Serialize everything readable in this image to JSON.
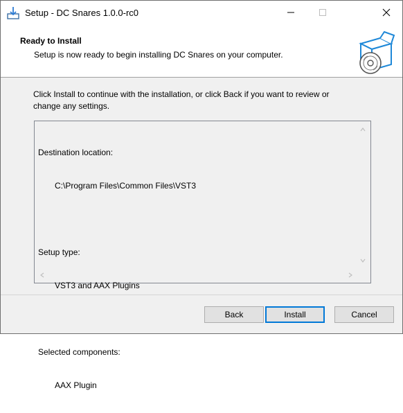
{
  "window": {
    "title": "Setup - DC Snares 1.0.0-rc0"
  },
  "header": {
    "title": "Ready to Install",
    "subtitle": "Setup is now ready to begin installing DC Snares on your computer."
  },
  "body": {
    "intro_line1": "Click Install to continue with the installation, or click Back if you want to review or",
    "intro_line2": "change any settings."
  },
  "memo": {
    "destination_label": "Destination location:",
    "destination_value": "C:\\Program Files\\Common Files\\VST3",
    "setup_type_label": "Setup type:",
    "setup_type_value": "VST3 and AAX Plugins",
    "components_label": "Selected components:",
    "components_value": "AAX Plugin"
  },
  "buttons": {
    "back": "Back",
    "install": "Install",
    "cancel": "Cancel"
  },
  "icons": {
    "app": "installer-icon",
    "header": "box-disc-icon"
  },
  "colors": {
    "accent": "#0078d7",
    "graphic_blue": "#1e88d8"
  }
}
